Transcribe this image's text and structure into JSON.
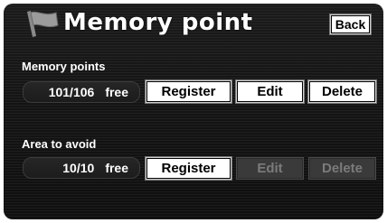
{
  "header": {
    "title": "Memory point",
    "back_label": "Back",
    "flag_icon": "flag-icon"
  },
  "memory_points": {
    "label": "Memory points",
    "count": "101/106",
    "free_label": "free",
    "register_label": "Register",
    "edit_label": "Edit",
    "delete_label": "Delete"
  },
  "area_to_avoid": {
    "label": "Area to avoid",
    "count": "10/10",
    "free_label": "free",
    "register_label": "Register",
    "edit_label": "Edit",
    "delete_label": "Delete",
    "edit_enabled": false,
    "delete_enabled": false
  },
  "colors": {
    "background": "#141414",
    "button": "#ffffff",
    "button_disabled": "#3a3a3a",
    "text": "#ffffff"
  }
}
